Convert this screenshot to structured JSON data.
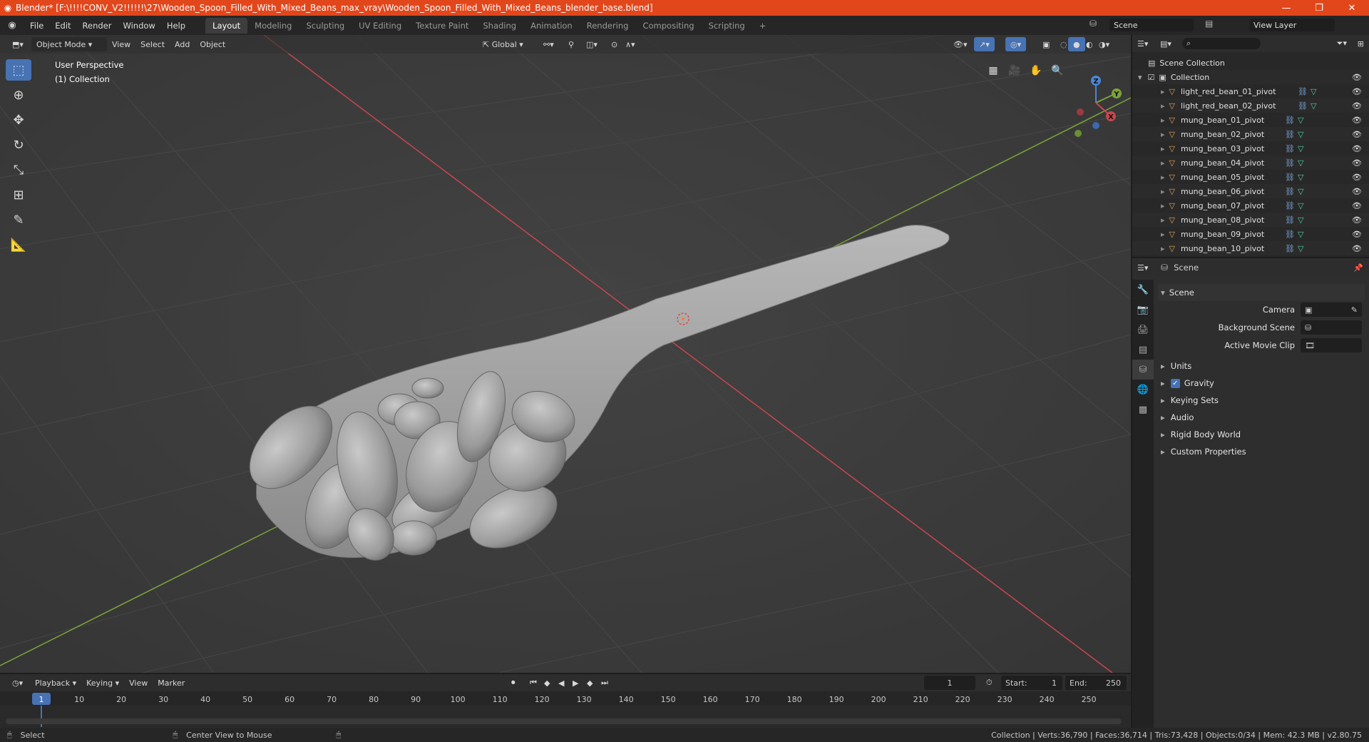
{
  "window": {
    "title": "Blender* [F:\\!!!!CONV_V2!!!!!!\\27\\Wooden_Spoon_Filled_With_Mixed_Beans_max_vray\\Wooden_Spoon_Filled_With_Mixed_Beans_blender_base.blend]",
    "minimize": "—",
    "restore": "❐",
    "close": "✕"
  },
  "menu": {
    "items": [
      "File",
      "Edit",
      "Render",
      "Window",
      "Help"
    ],
    "workspaces": [
      "Layout",
      "Modeling",
      "Sculpting",
      "UV Editing",
      "Texture Paint",
      "Shading",
      "Animation",
      "Rendering",
      "Compositing",
      "Scripting"
    ],
    "active_workspace": "Layout",
    "add_tab": "+",
    "scene": "Scene",
    "view_layer": "View Layer"
  },
  "viewport": {
    "mode": "Object Mode",
    "menus": [
      "View",
      "Select",
      "Add",
      "Object"
    ],
    "orientation": "Global",
    "perspective_label": "User Perspective",
    "collection_label": "(1) Collection",
    "gizmo": {
      "x": "X",
      "y": "Y",
      "z": "Z"
    }
  },
  "outliner": {
    "root": "Scene Collection",
    "collection": "Collection",
    "items": [
      "light_red_bean_01_pivot",
      "light_red_bean_02_pivot",
      "mung_bean_01_pivot",
      "mung_bean_02_pivot",
      "mung_bean_03_pivot",
      "mung_bean_04_pivot",
      "mung_bean_05_pivot",
      "mung_bean_06_pivot",
      "mung_bean_07_pivot",
      "mung_bean_08_pivot",
      "mung_bean_09_pivot",
      "mung_bean_10_pivot"
    ]
  },
  "properties": {
    "context": "Scene",
    "panel": "Scene",
    "fields": {
      "camera": "Camera",
      "background_scene": "Background Scene",
      "active_movie_clip": "Active Movie Clip"
    },
    "sections": [
      "Units",
      "Gravity",
      "Keying Sets",
      "Audio",
      "Rigid Body World",
      "Custom Properties"
    ],
    "gravity_checked": true
  },
  "timeline": {
    "menus": [
      "Playback",
      "Keying",
      "View",
      "Marker"
    ],
    "current_frame": "1",
    "start_label": "Start:",
    "start": "1",
    "end_label": "End:",
    "end": "250",
    "ruler": [
      "1",
      "10",
      "20",
      "30",
      "40",
      "50",
      "60",
      "70",
      "80",
      "90",
      "100",
      "110",
      "120",
      "130",
      "140",
      "150",
      "160",
      "170",
      "180",
      "190",
      "200",
      "210",
      "220",
      "230",
      "240",
      "250"
    ]
  },
  "status": {
    "left": "Select",
    "middle": "Center View to Mouse",
    "right": "Collection | Verts:36,790 | Faces:36,714 | Tris:73,428 | Objects:0/34 | Mem: 42.3 MB | v2.80.75"
  },
  "colors": {
    "titlebar": "#e2471c",
    "accent": "#4772b3",
    "x_axis": "#c8464e",
    "y_axis": "#7ca33a",
    "z_axis": "#4a86d6"
  }
}
